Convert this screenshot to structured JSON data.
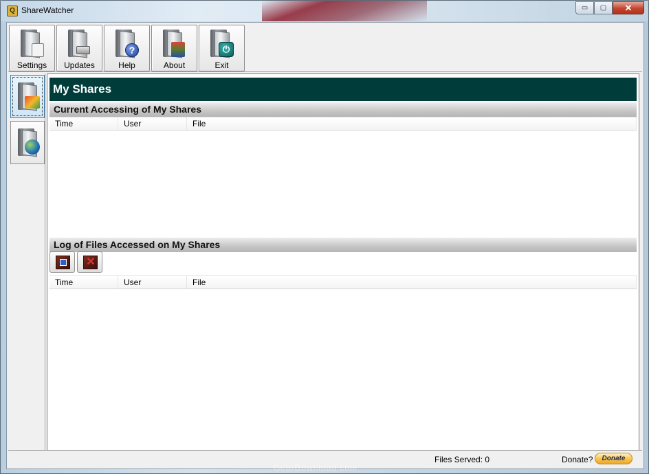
{
  "window": {
    "title": "ShareWatcher",
    "minimize_glyph": "▭",
    "maximize_glyph": "▢",
    "close_glyph": "✕"
  },
  "toolbar": {
    "items": [
      {
        "label": "Settings",
        "icon": "settings-folder-icon"
      },
      {
        "label": "Updates",
        "icon": "updates-folder-icon"
      },
      {
        "label": "Help",
        "icon": "help-folder-icon"
      },
      {
        "label": "About",
        "icon": "about-folder-icon"
      },
      {
        "label": "Exit",
        "icon": "exit-folder-icon"
      }
    ]
  },
  "sidenav": {
    "items": [
      {
        "icon": "my-shares-folder-icon",
        "active": true
      },
      {
        "icon": "network-folder-icon",
        "active": false
      }
    ]
  },
  "main": {
    "title": "My Shares",
    "current_section": {
      "header": "Current Accessing of My Shares",
      "columns": [
        "Time",
        "User",
        "File"
      ],
      "rows": []
    },
    "log_section": {
      "header": "Log of Files Accessed on My Shares",
      "tools": [
        {
          "icon": "save-log-icon"
        },
        {
          "icon": "clear-log-icon"
        }
      ],
      "columns": [
        "Time",
        "User",
        "File"
      ],
      "rows": []
    }
  },
  "status": {
    "files_served": "Files Served: 0",
    "donate_question": "Donate?",
    "donate_label": "Donate"
  },
  "watermark": "GearDownload.com",
  "colors": {
    "title_band": "#003c3a",
    "donate_button": "#f8c554"
  }
}
